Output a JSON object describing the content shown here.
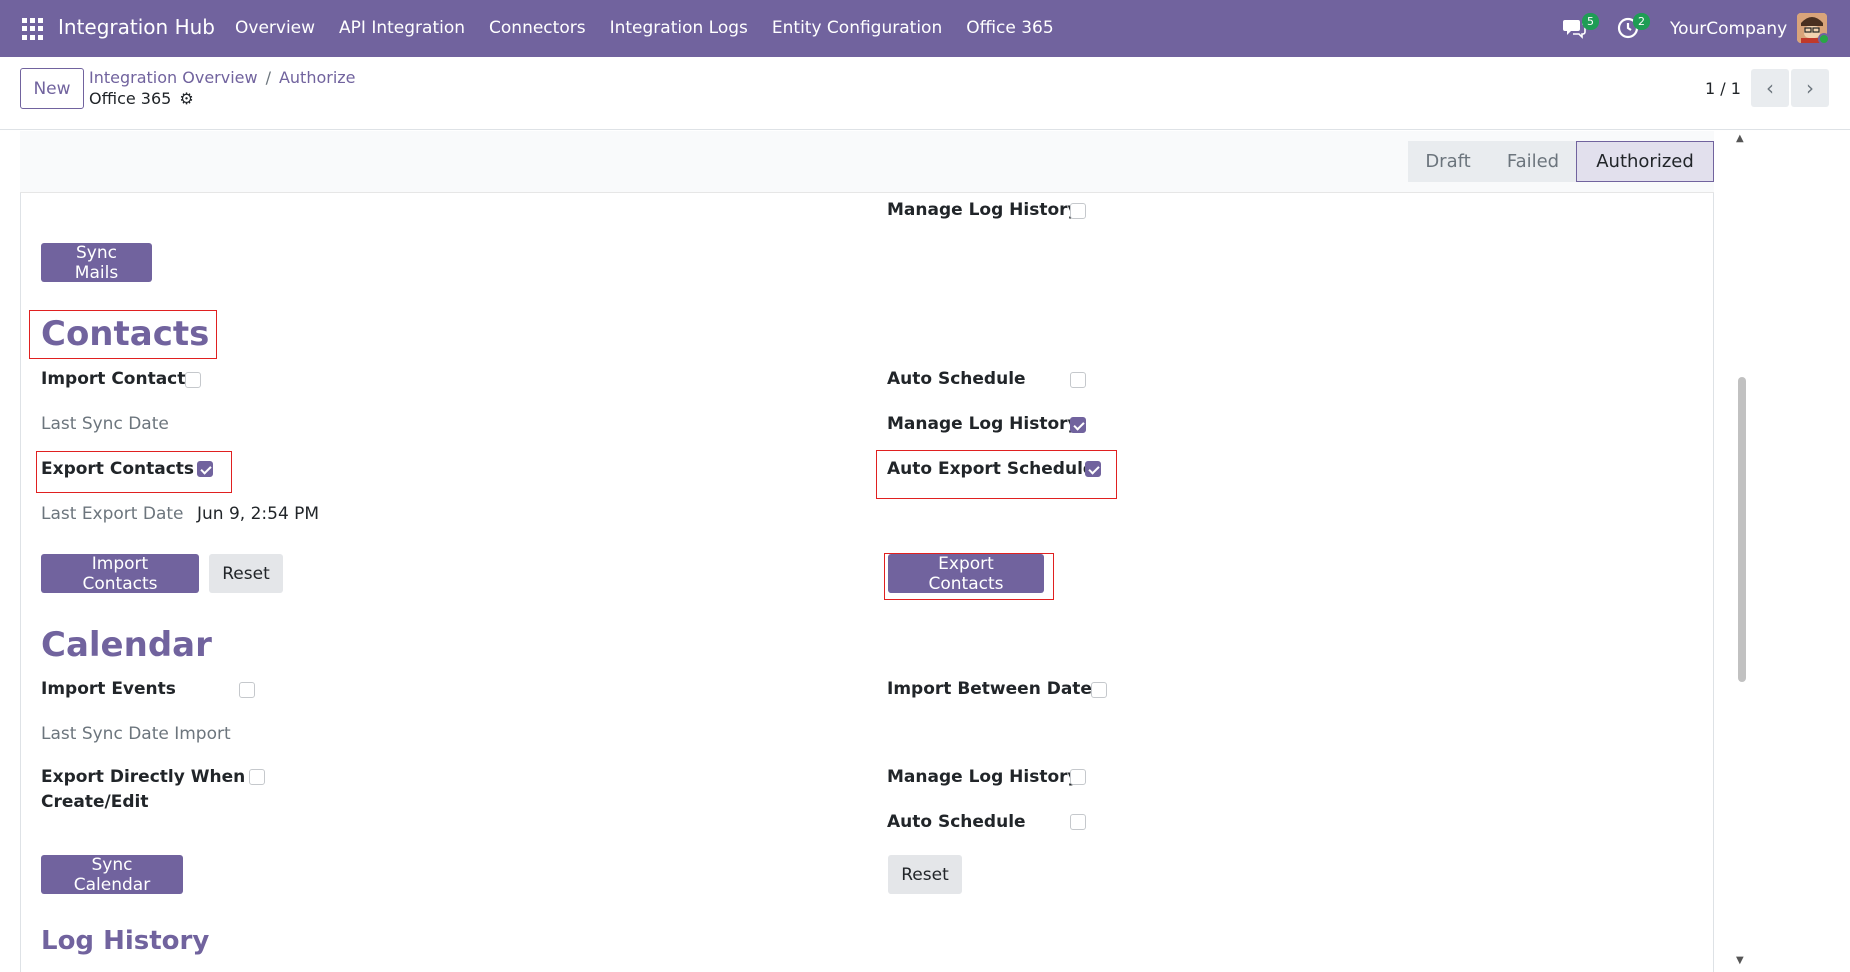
{
  "navbar": {
    "brand": "Integration Hub",
    "menu": [
      "Overview",
      "API Integration",
      "Connectors",
      "Integration Logs",
      "Entity Configuration",
      "Office 365"
    ],
    "messages_count": "5",
    "activities_count": "2",
    "company": "YourCompany",
    "bg_color": "#71639e"
  },
  "control": {
    "new_label": "New",
    "breadcrumb_parent": "Integration Overview",
    "breadcrumb_separator": "/",
    "breadcrumb_current": "Authorize",
    "record_name": "Office 365",
    "pager": "1 / 1"
  },
  "statusbar": {
    "stages": [
      "Draft",
      "Failed",
      "Authorized"
    ],
    "active": "Authorized"
  },
  "mail_section": {
    "manage_log_history_label": "Manage Log History",
    "manage_log_history": false,
    "sync_button": "Sync Mails"
  },
  "contacts": {
    "heading": "Contacts",
    "import_contact_label": "Import Contact",
    "import_contact": false,
    "last_sync_date_label": "Last Sync Date",
    "export_contacts_label": "Export Contacts",
    "export_contacts": true,
    "last_export_date_label": "Last Export Date",
    "last_export_date": "Jun 9, 2:54 PM",
    "auto_schedule_label": "Auto Schedule",
    "auto_schedule": false,
    "manage_log_history_label": "Manage Log History",
    "manage_log_history": true,
    "auto_export_schedule_label": "Auto Export Schedule",
    "auto_export_schedule": true,
    "import_button": "Import Contacts",
    "reset_button": "Reset",
    "export_button": "Export Contacts"
  },
  "calendar": {
    "heading": "Calendar",
    "import_events_label": "Import Events",
    "import_events": false,
    "last_sync_date_import_label": "Last Sync Date Import",
    "export_directly_label_line1": "Export Directly When",
    "export_directly_label_line2": "Create/Edit",
    "export_directly": false,
    "import_between_dates_label": "Import Between Dates",
    "import_between_dates": false,
    "manage_log_history_label": "Manage Log History",
    "manage_log_history": false,
    "auto_schedule_label": "Auto Schedule",
    "auto_schedule": false,
    "sync_button": "Sync Calendar",
    "reset_button": "Reset"
  },
  "log_history": {
    "heading": "Log History"
  }
}
